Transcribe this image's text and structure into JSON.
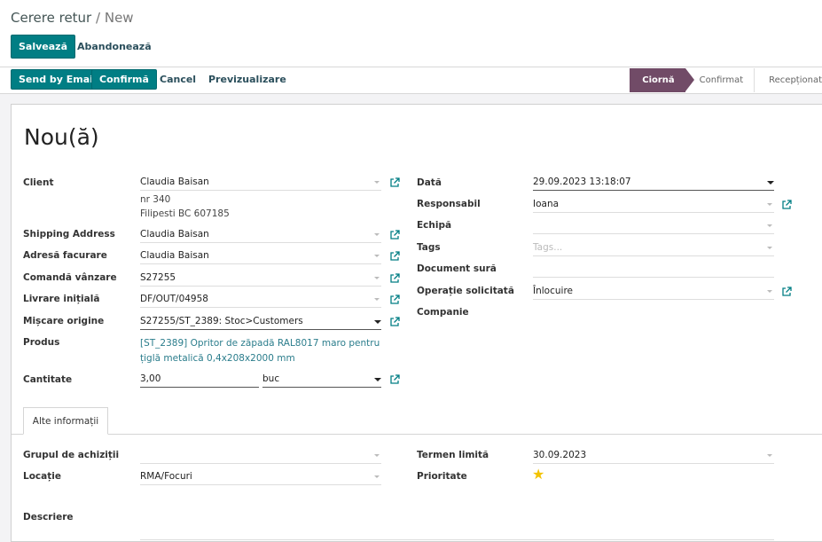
{
  "breadcrumb": {
    "parent": "Cerere retur",
    "separator": "/",
    "current": "New"
  },
  "actions": {
    "save": "Salvează",
    "discard": "Abandonează"
  },
  "statusbar": {
    "buttons": [
      "Send by Email",
      "Confirmă",
      "Cancel",
      "Previzualizare"
    ],
    "stages": [
      "Ciornă",
      "Confirmat",
      "Recepționat"
    ],
    "active_stage": "Ciornă",
    "accent": "#714b67"
  },
  "brand_color": "#017e84",
  "form": {
    "title": "Nou(ă)",
    "left": {
      "client": {
        "label": "Client",
        "value": "Claudia Baisan",
        "address_line1": "nr 340",
        "address_line2": "Filipesti BC 607185"
      },
      "shipping": {
        "label": "Shipping Address",
        "value": "Claudia Baisan"
      },
      "invoice": {
        "label": "Adresă facurare",
        "value": "Claudia Baisan"
      },
      "sale_order": {
        "label": "Comandă vânzare",
        "value": "S27255"
      },
      "delivery": {
        "label": "Livrare inițială",
        "value": "DF/OUT/04958"
      },
      "origin_move": {
        "label": "Mișcare origine",
        "value": "S27255/ST_2389: Stoc>Customers"
      },
      "product": {
        "label": "Produs",
        "line1": "[ST_2389] Opritor de zăpadă RAL8017 maro pentru",
        "line2": "țiglă metalică 0,4x208x2000 mm"
      },
      "quantity": {
        "label": "Cantitate",
        "value": "3,00",
        "uom": "buc"
      }
    },
    "right": {
      "date": {
        "label": "Dată",
        "value": "29.09.2023 13:18:07"
      },
      "responsible": {
        "label": "Responsabil",
        "value": "Ioana"
      },
      "team": {
        "label": "Echipă",
        "value": ""
      },
      "tags": {
        "label": "Tags",
        "placeholder": "Tags..."
      },
      "source_doc": {
        "label": "Document sură",
        "value": ""
      },
      "operation": {
        "label": "Operație solicitată",
        "value": "Înlocuire"
      },
      "company": {
        "label": "Companie"
      }
    },
    "tab": {
      "label": "Alte informații"
    },
    "other": {
      "procurement": {
        "label": "Grupul de achiziții",
        "value": ""
      },
      "location": {
        "label": "Locație",
        "value": "RMA/Focuri"
      },
      "deadline": {
        "label": "Termen limită",
        "value": "30.09.2023"
      },
      "priority": {
        "label": "Prioritate",
        "stars": 1,
        "icon": "star-icon"
      },
      "description": {
        "label": "Descriere"
      }
    }
  }
}
